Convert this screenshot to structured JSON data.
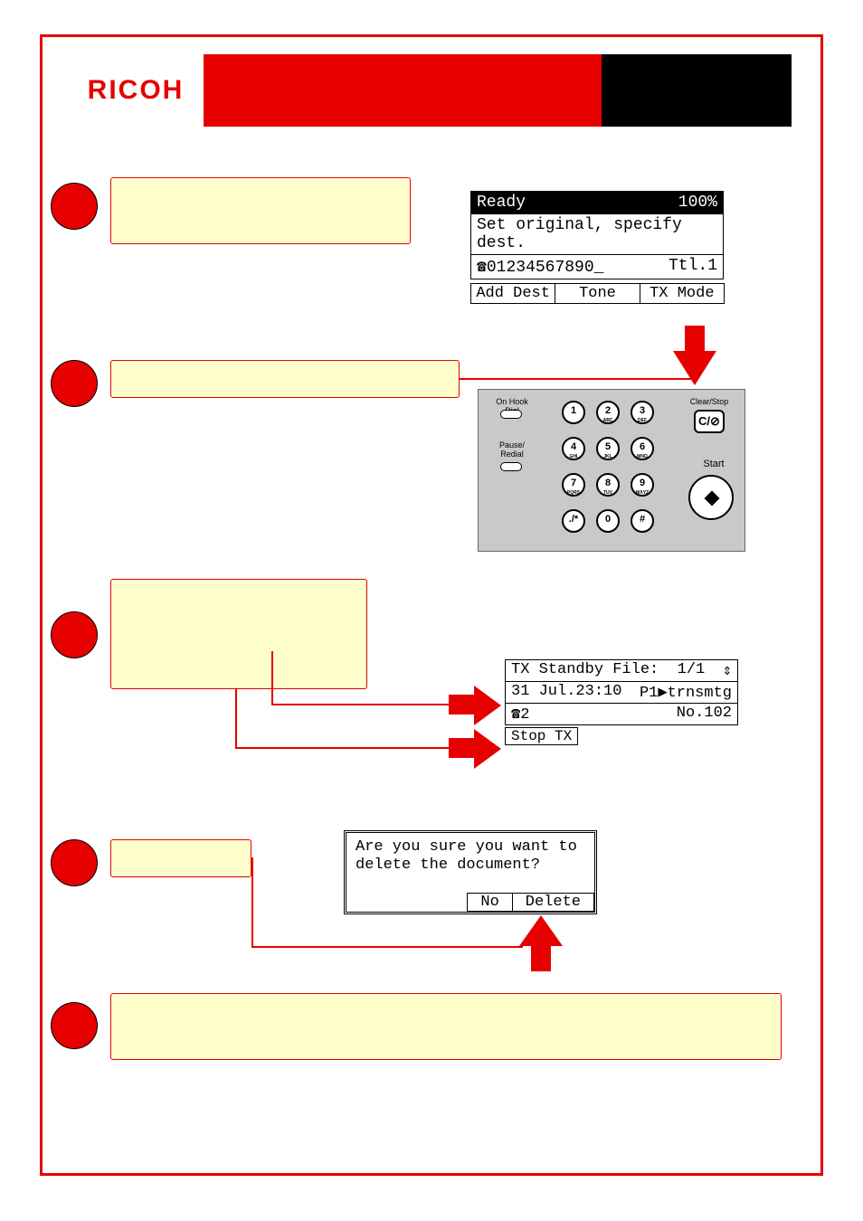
{
  "logo": "RICOH",
  "lcd1": {
    "status_left": "Ready",
    "status_right": "100%",
    "line2": "Set original, specify dest.",
    "line3_left": "☎01234567890_",
    "line3_right": "Ttl.1",
    "tabs": [
      "Add Dest",
      "Tone",
      "TX Mode"
    ]
  },
  "keypad": {
    "on_hook": "On Hook Dial",
    "pause": "Pause/\nRedial",
    "clear": "Clear/Stop",
    "clear_btn": "C/⊘",
    "start": "Start",
    "keys": [
      {
        "n": "1",
        "s": ""
      },
      {
        "n": "2",
        "s": "ABC"
      },
      {
        "n": "3",
        "s": "DEF"
      },
      {
        "n": "4",
        "s": "GHI"
      },
      {
        "n": "5",
        "s": "JKL"
      },
      {
        "n": "6",
        "s": "MNO"
      },
      {
        "n": "7",
        "s": "PQRS"
      },
      {
        "n": "8",
        "s": "TUV"
      },
      {
        "n": "9",
        "s": "WXYZ"
      },
      {
        "n": "./*",
        "s": ""
      },
      {
        "n": "0",
        "s": ""
      },
      {
        "n": "#",
        "s": ""
      }
    ]
  },
  "lcd2": {
    "title_left": "TX Standby File:",
    "title_right": "1/1",
    "arrow": "⇕",
    "line2_left": "31 Jul.23:10",
    "line2_right": "P1▶trnsmtg",
    "line3_left": "☎2",
    "line3_right": "No.102",
    "stop": "Stop TX"
  },
  "dialog": {
    "msg1": "Are you sure you want to",
    "msg2": "delete the document?",
    "no": "No",
    "delete": "Delete"
  }
}
